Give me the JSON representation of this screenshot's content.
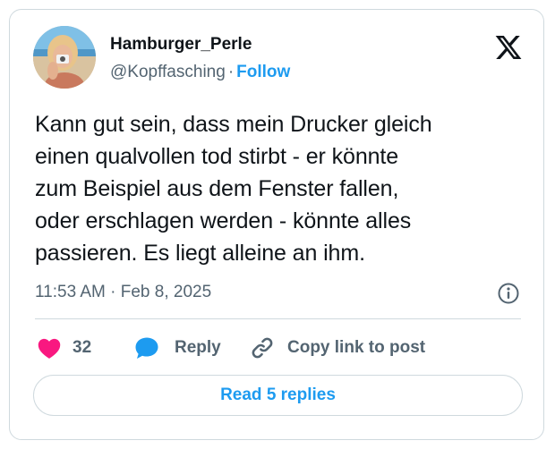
{
  "author": {
    "display_name": "Hamburger_Perle",
    "handle": "@Kopffasching",
    "separator": "·",
    "follow_label": "Follow"
  },
  "tweet": {
    "text": "Kann gut sein, dass mein Drucker gleich\neinen qualvollen tod stirbt - er könnte\nzum Beispiel aus dem Fenster fallen,\noder erschlagen werden - könnte alles\npassieren. Es liegt alleine an ihm.",
    "timestamp": "11:53 AM · Feb 8, 2025"
  },
  "actions": {
    "like_count": "32",
    "reply_label": "Reply",
    "copy_link_label": "Copy link to post"
  },
  "footer": {
    "read_replies_label": "Read 5 replies"
  },
  "icons": {
    "brand": "x-logo-icon",
    "info": "info-icon",
    "like": "heart-icon",
    "reply": "speech-bubble-icon",
    "copy": "link-icon"
  },
  "colors": {
    "accent": "#1d9bf0",
    "like": "#f91880",
    "text_primary": "#0f1419",
    "text_secondary": "#536471",
    "border": "#cfd9de"
  }
}
